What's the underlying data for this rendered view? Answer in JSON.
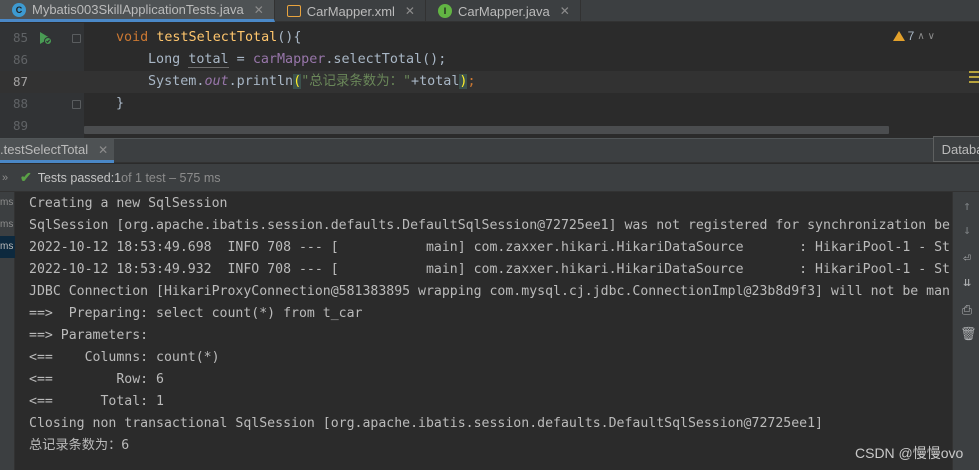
{
  "tabs": [
    {
      "label": "Mybatis003SkillApplicationTests.java",
      "icon": "class-icon",
      "active": true
    },
    {
      "label": "CarMapper.xml",
      "icon": "xml-icon",
      "active": false
    },
    {
      "label": "CarMapper.java",
      "icon": "interface-icon",
      "active": false
    }
  ],
  "editor": {
    "lines": [
      {
        "num": "85",
        "t1": "void",
        "t2": "testSelectTotal",
        "t3": "(){"
      },
      {
        "num": "86",
        "t1": "Long ",
        "t2": "total",
        "t3": " = ",
        "t4": "carMapper",
        "t5": ".selectTotal();"
      },
      {
        "num": "87",
        "t1": "System.",
        "t2": "out",
        "t3": ".println",
        "t4": "(",
        "t5": "\"总记录条数为：\"",
        "t6": "+",
        "t7": "total",
        "t8": ")",
        "t9": ";"
      },
      {
        "num": "88",
        "t1": "}"
      },
      {
        "num": "89"
      }
    ],
    "warning_count": "7"
  },
  "run": {
    "tab_label": ".testSelectTotal",
    "database_button": "Databas",
    "status": {
      "passed": "Tests passed: ",
      "count": "1",
      "rest": " of 1 test – 575 ms"
    },
    "left_items": [
      "ms",
      "ms",
      "ms"
    ],
    "console": [
      "Creating a new SqlSession",
      "SqlSession [org.apache.ibatis.session.defaults.DefaultSqlSession@72725ee1] was not registered for synchronization be",
      "2022-10-12 18:53:49.698  INFO 708 --- [           main] com.zaxxer.hikari.HikariDataSource       : HikariPool-1 - St",
      "2022-10-12 18:53:49.932  INFO 708 --- [           main] com.zaxxer.hikari.HikariDataSource       : HikariPool-1 - St",
      "JDBC Connection [HikariProxyConnection@581383895 wrapping com.mysql.cj.jdbc.ConnectionImpl@23b8d9f3] will not be man",
      "==>  Preparing: select count(*) from t_car",
      "==> Parameters: ",
      "<==    Columns: count(*)",
      "<==        Row: 6",
      "<==      Total: 1",
      "Closing non transactional SqlSession [org.apache.ibatis.session.defaults.DefaultSqlSession@72725ee1]",
      "总记录条数为：6"
    ]
  },
  "watermark": "CSDN @慢慢ovo"
}
